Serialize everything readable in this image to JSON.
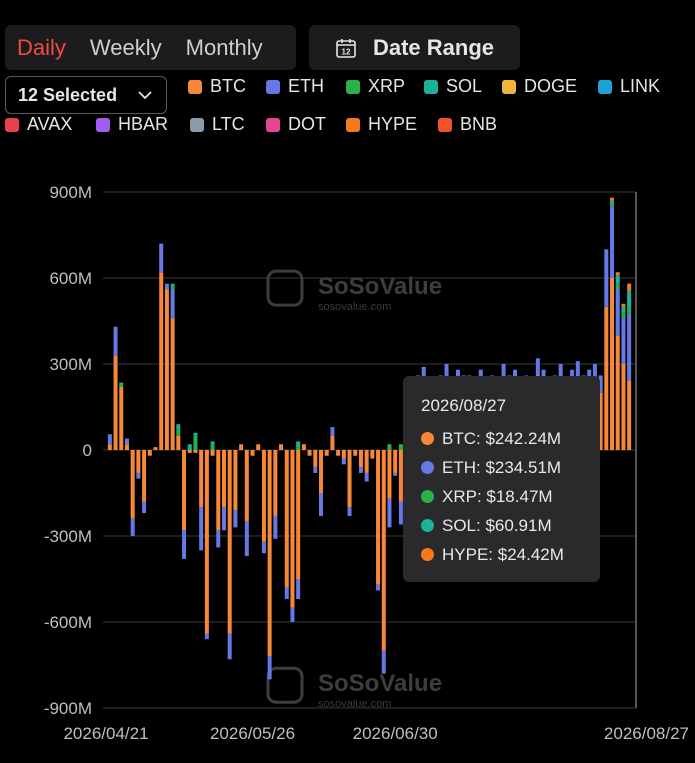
{
  "period_tabs": [
    {
      "label": "Daily",
      "active": true
    },
    {
      "label": "Weekly",
      "active": false
    },
    {
      "label": "Monthly",
      "active": false
    }
  ],
  "date_range": {
    "label": "Date Range",
    "icon": "calendar-icon",
    "day": "12"
  },
  "asset_select": {
    "label": "12 Selected"
  },
  "legend": [
    {
      "name": "BTC",
      "color": "#f7883a"
    },
    {
      "name": "ETH",
      "color": "#6678e6"
    },
    {
      "name": "XRP",
      "color": "#29b04a"
    },
    {
      "name": "SOL",
      "color": "#1ab29b"
    },
    {
      "name": "DOGE",
      "color": "#f0b43c"
    },
    {
      "name": "LINK",
      "color": "#1ca3d6"
    },
    {
      "name": "AVAX",
      "color": "#e8414d"
    },
    {
      "name": "HBAR",
      "color": "#a35cf2"
    },
    {
      "name": "LTC",
      "color": "#8b9aab"
    },
    {
      "name": "DOT",
      "color": "#e64593"
    },
    {
      "name": "HYPE",
      "color": "#f77a1a"
    },
    {
      "name": "BNB",
      "color": "#f0522c"
    }
  ],
  "watermark": {
    "brand": "SoSoValue",
    "url": "sosovalue.com"
  },
  "tooltip": {
    "date": "2026/08/27",
    "rows": [
      {
        "label": "BTC: $242.24M",
        "color": "#f7883a"
      },
      {
        "label": "ETH: $234.51M",
        "color": "#6678e6"
      },
      {
        "label": "XRP: $18.47M",
        "color": "#29b04a"
      },
      {
        "label": "SOL: $60.91M",
        "color": "#1ab29b"
      },
      {
        "label": "HYPE: $24.42M",
        "color": "#f77a1a"
      }
    ]
  },
  "chart_data": {
    "type": "bar",
    "stacked": true,
    "ylim": [
      -900,
      900
    ],
    "y_ticks": [
      {
        "value": 900,
        "label": "900M"
      },
      {
        "value": 600,
        "label": "600M"
      },
      {
        "value": 300,
        "label": "300M"
      },
      {
        "value": 0,
        "label": "0"
      },
      {
        "value": -300,
        "label": "-300M"
      },
      {
        "value": -600,
        "label": "-600M"
      },
      {
        "value": -900,
        "label": "-900M"
      }
    ],
    "x_ticks": [
      {
        "index": 0,
        "label": "2026/04/21"
      },
      {
        "index": 25,
        "label": "2026/05/26"
      },
      {
        "index": 50,
        "label": "2026/06/30"
      },
      {
        "index": 91,
        "label": "2026/08/27"
      }
    ],
    "grid": true,
    "series": [
      {
        "name": "BTC",
        "color": "#f7883a",
        "values": [
          20,
          330,
          220,
          20,
          -240,
          -80,
          -180,
          -20,
          10,
          620,
          560,
          460,
          50,
          -280,
          -10,
          -10,
          -200,
          -640,
          -20,
          -280,
          -200,
          -640,
          -210,
          20,
          -250,
          -20,
          20,
          -320,
          -720,
          -230,
          20,
          -480,
          -550,
          -450,
          20,
          -20,
          -60,
          -150,
          -20,
          50,
          -20,
          -30,
          -200,
          -20,
          -60,
          -80,
          -30,
          -470,
          -700,
          -170,
          -80,
          -180,
          -70,
          -240,
          220,
          240,
          180,
          160,
          200,
          240,
          180,
          220,
          200,
          200,
          180,
          220,
          160,
          200,
          180,
          240,
          200,
          220,
          180,
          200,
          180,
          260,
          220,
          180,
          200,
          240,
          180,
          220,
          250,
          200,
          220,
          240,
          200,
          500,
          600,
          400,
          300,
          242.24
        ]
      },
      {
        "name": "ETH",
        "color": "#6678e6",
        "values": [
          35,
          100,
          0,
          20,
          -60,
          -20,
          -40,
          0,
          0,
          100,
          20,
          100,
          0,
          -100,
          0,
          0,
          -150,
          -20,
          0,
          -60,
          -80,
          -90,
          -60,
          0,
          -120,
          0,
          0,
          -40,
          -80,
          -80,
          0,
          -40,
          -50,
          -70,
          0,
          0,
          -20,
          -80,
          0,
          30,
          0,
          -20,
          -30,
          0,
          -20,
          -30,
          0,
          -20,
          -80,
          -100,
          -10,
          -80,
          0,
          -60,
          40,
          50,
          60,
          60,
          60,
          60,
          60,
          60,
          60,
          60,
          60,
          60,
          60,
          60,
          60,
          60,
          60,
          60,
          60,
          60,
          60,
          60,
          60,
          60,
          60,
          60,
          60,
          60,
          60,
          60,
          60,
          60,
          60,
          200,
          250,
          160,
          160,
          234.51
        ]
      },
      {
        "name": "XRP",
        "color": "#29b04a",
        "values": [
          0,
          0,
          10,
          0,
          0,
          0,
          0,
          0,
          0,
          0,
          0,
          10,
          20,
          0,
          0,
          50,
          0,
          0,
          20,
          0,
          0,
          0,
          0,
          0,
          0,
          0,
          0,
          0,
          0,
          0,
          0,
          0,
          0,
          10,
          0,
          0,
          0,
          0,
          0,
          0,
          0,
          0,
          0,
          0,
          0,
          0,
          0,
          0,
          0,
          20,
          0,
          20,
          0,
          0,
          0,
          0,
          0,
          0,
          0,
          0,
          0,
          0,
          0,
          0,
          0,
          0,
          0,
          0,
          0,
          0,
          0,
          0,
          0,
          0,
          0,
          0,
          0,
          0,
          0,
          0,
          0,
          0,
          0,
          0,
          0,
          0,
          0,
          0,
          10,
          20,
          20,
          18.47
        ]
      },
      {
        "name": "SOL",
        "color": "#1ab29b",
        "values": [
          0,
          0,
          5,
          0,
          0,
          0,
          0,
          0,
          0,
          0,
          0,
          10,
          20,
          0,
          20,
          10,
          0,
          0,
          10,
          0,
          0,
          0,
          0,
          0,
          0,
          0,
          0,
          0,
          0,
          0,
          0,
          0,
          0,
          20,
          0,
          0,
          0,
          0,
          0,
          0,
          0,
          0,
          0,
          0,
          0,
          0,
          0,
          0,
          0,
          0,
          0,
          0,
          0,
          0,
          0,
          0,
          0,
          0,
          0,
          0,
          0,
          0,
          0,
          0,
          0,
          0,
          0,
          0,
          0,
          0,
          0,
          0,
          0,
          0,
          0,
          0,
          0,
          0,
          0,
          0,
          0,
          0,
          0,
          0,
          0,
          0,
          0,
          0,
          10,
          30,
          20,
          60.91
        ]
      },
      {
        "name": "HYPE",
        "color": "#f77a1a",
        "values": [
          0,
          0,
          0,
          0,
          0,
          0,
          0,
          0,
          0,
          0,
          0,
          0,
          0,
          0,
          0,
          0,
          0,
          0,
          0,
          0,
          0,
          0,
          0,
          0,
          0,
          0,
          0,
          0,
          0,
          0,
          0,
          0,
          0,
          0,
          0,
          0,
          0,
          0,
          0,
          0,
          0,
          0,
          0,
          0,
          0,
          0,
          0,
          0,
          0,
          0,
          0,
          0,
          0,
          0,
          0,
          0,
          0,
          0,
          0,
          0,
          0,
          0,
          0,
          0,
          0,
          0,
          0,
          0,
          0,
          0,
          0,
          0,
          0,
          0,
          0,
          0,
          0,
          0,
          0,
          0,
          0,
          0,
          0,
          0,
          0,
          0,
          0,
          0,
          10,
          10,
          10,
          24.42
        ]
      }
    ]
  }
}
